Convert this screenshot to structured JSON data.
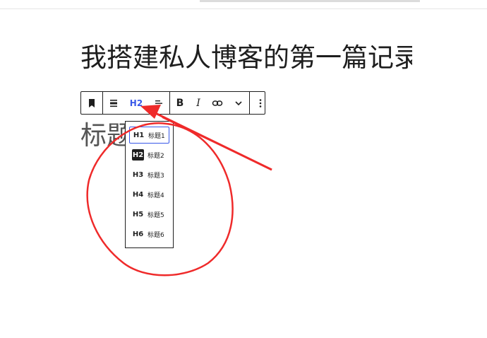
{
  "editor": {
    "post_title": "我搭建私人博客的第一篇记录",
    "heading_text": "标题"
  },
  "toolbar": {
    "heading_level": "H2",
    "bold_label": "B",
    "italic_label": "I"
  },
  "heading_menu": {
    "items": [
      {
        "level": "H1",
        "label": "标题1"
      },
      {
        "level": "H2",
        "label": "标题2"
      },
      {
        "level": "H3",
        "label": "标题3"
      },
      {
        "level": "H4",
        "label": "标题4"
      },
      {
        "level": "H5",
        "label": "标题5"
      },
      {
        "level": "H6",
        "label": "标题6"
      }
    ],
    "focused_index": 0,
    "active_index": 1
  },
  "colors": {
    "accent": "#3858e9",
    "annotation": "#ef2a2a"
  },
  "icons": [
    "bookmark-icon",
    "align-icon",
    "justify-icon",
    "link-icon",
    "chevron-down-icon",
    "more-vertical-icon"
  ]
}
